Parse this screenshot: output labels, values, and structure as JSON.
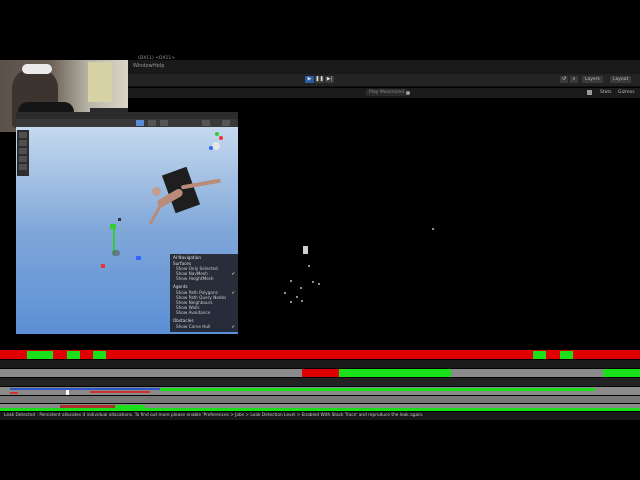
{
  "menubar": {
    "items": [
      "Window",
      "Help"
    ],
    "title_fragment": "(DX11) <DX11>"
  },
  "toolbar": {
    "layers_label": "Layers",
    "layout_label": "Layout",
    "play_icon": "play-icon",
    "pause_icon": "pause-icon",
    "step_icon": "step-icon"
  },
  "game_toolbar": {
    "play_mode_label": "Play Maximized",
    "stats_label": "Stats",
    "gizmos_label": "Gizmos"
  },
  "navmesh_overlay": {
    "header": "AI Navigation",
    "sections": [
      {
        "title": "Surfaces",
        "items": [
          {
            "label": "Show Only Selected",
            "checked": false
          },
          {
            "label": "Show NavMesh",
            "checked": true
          },
          {
            "label": "Show HeightMesh",
            "checked": false
          }
        ]
      },
      {
        "title": "Agents",
        "items": [
          {
            "label": "Show Path Polygons",
            "checked": true
          },
          {
            "label": "Show Path Query Nodes",
            "checked": false
          },
          {
            "label": "Show Neighbours",
            "checked": false
          },
          {
            "label": "Show Walls",
            "checked": false
          },
          {
            "label": "Show Avoidance",
            "checked": false
          }
        ]
      },
      {
        "title": "Obstacles",
        "items": [
          {
            "label": "Show Carve Hull",
            "checked": true
          }
        ]
      }
    ]
  },
  "status": {
    "message": "Leak Detected : Persistent allocates 4 individual allocations. To find out more please enable 'Preferences > Jobs > Leak Detection Level > Enabled With Stack Trace' and reproduce the leak again."
  },
  "colors": {
    "profiler_red": "#e00000",
    "profiler_green": "#19e019",
    "profiler_gray": "#8a8a8a",
    "editor_dark": "#191919"
  }
}
